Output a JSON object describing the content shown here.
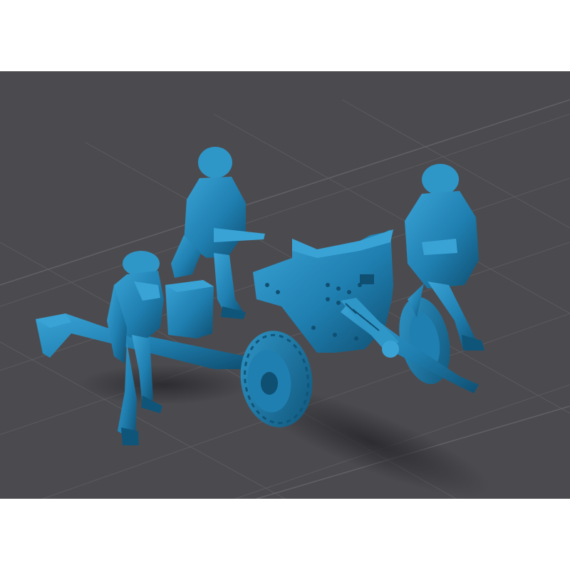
{
  "viewport": {
    "background_color": "#4b4b4f",
    "grid_color": "#5b5b60",
    "model_color": "#1f7fb0",
    "model_highlight": "#3aa3d6",
    "model_shadow": "#0f4f72",
    "ground_shadow": "#2f2f33"
  },
  "scene": {
    "subject": "miniature-model-anti-tank-gun-with-three-crew",
    "crew_count": 3
  }
}
